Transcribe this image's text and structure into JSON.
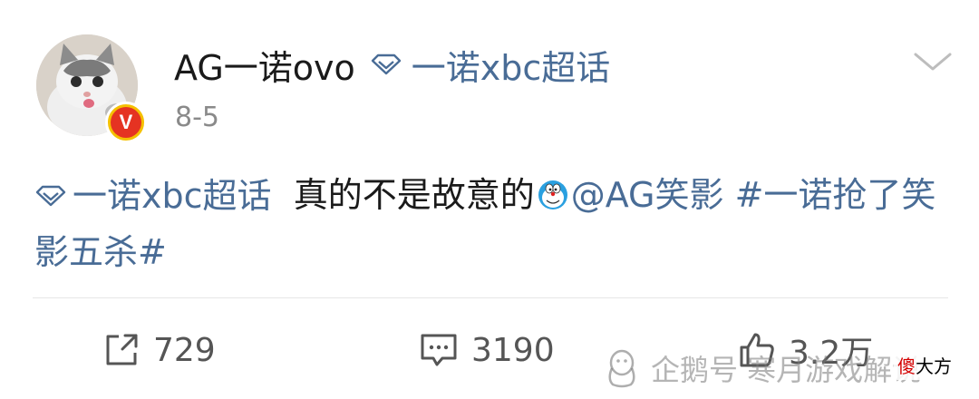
{
  "post": {
    "username": "AG一诺ovo",
    "super_topic_label": "一诺xbc超话",
    "timestamp": "8-5",
    "body": {
      "topic_label": "一诺xbc超话",
      "text": "真的不是故意的",
      "mention": "@AG笑影",
      "hashtag": "#一诺抢了笑影五杀#"
    }
  },
  "actions": {
    "repost_count": "729",
    "comment_count": "3190",
    "like_count": "3.2万"
  },
  "watermark": {
    "text": "企鹅号 寒月游戏解说",
    "tag_highlight": "傻",
    "tag_rest": "大方"
  },
  "colors": {
    "link": "#496c96",
    "text": "#1a1a1a",
    "muted": "#8a8a8a",
    "badge_red": "#e53322",
    "badge_gold": "#f5c000"
  },
  "icons": {
    "topic": "super-topic-diamond-icon",
    "menu": "chevron-down-icon",
    "repost": "repost-icon",
    "comment": "comment-icon",
    "like": "thumbs-up-icon"
  }
}
